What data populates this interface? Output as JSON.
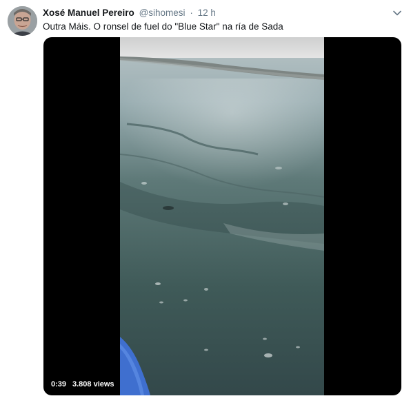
{
  "tweet": {
    "display_name": "Xosé Manuel Pereiro",
    "username": "@sihomesi",
    "separator": "·",
    "timestamp": "12 h",
    "text": "Outra Máis. O ronsel de fuel do \"Blue Star\" na ría de Sada"
  },
  "media": {
    "duration": "0:39",
    "views": "3.808 views",
    "icons": {
      "menu": "chevron-down-icon"
    }
  },
  "colors": {
    "secondary_text": "#657786",
    "primary_text": "#14171a",
    "water": "#3f5a58",
    "sky": "#dcdcdc"
  }
}
